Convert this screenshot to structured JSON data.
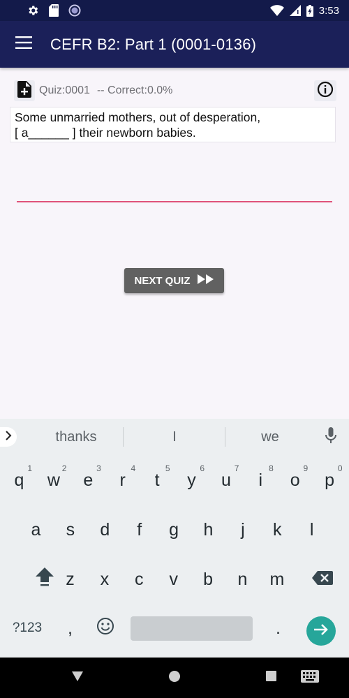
{
  "status_bar": {
    "time": "3:53",
    "icons": [
      "settings-icon",
      "sd-card-icon",
      "sync-circle-icon",
      "wifi-icon",
      "signal-icon",
      "battery-icon"
    ]
  },
  "app_bar": {
    "title": "CEFR B2: Part 1 (0001-0136)",
    "menu_icon": "hamburger-menu-icon",
    "color": "#1b2059"
  },
  "quiz": {
    "label": "Quiz:0001",
    "correct": "-- Correct:0.0%",
    "question_line1": "Some unmarried mothers, out of desperation,",
    "question_line2": "[ a______ ] their newborn babies.",
    "answer_value": "",
    "next_label": "NEXT QUIZ",
    "accent_color": "#e0527a"
  },
  "keyboard": {
    "suggestions": [
      "thanks",
      "I",
      "we"
    ],
    "row1": [
      "q",
      "w",
      "e",
      "r",
      "t",
      "y",
      "u",
      "i",
      "o",
      "p"
    ],
    "row1_hints": [
      "1",
      "2",
      "3",
      "4",
      "5",
      "6",
      "7",
      "8",
      "9",
      "0"
    ],
    "row2": [
      "a",
      "s",
      "d",
      "f",
      "g",
      "h",
      "j",
      "k",
      "l"
    ],
    "row3": [
      "z",
      "x",
      "c",
      "v",
      "b",
      "n",
      "m"
    ],
    "symbols_label": "?123",
    "comma": ",",
    "period": ".",
    "enter_color": "#26a69a"
  },
  "nav_bar": {
    "buttons": [
      "back-triangle-icon",
      "home-circle-icon",
      "recents-square-icon",
      "keyboard-switch-icon"
    ]
  }
}
